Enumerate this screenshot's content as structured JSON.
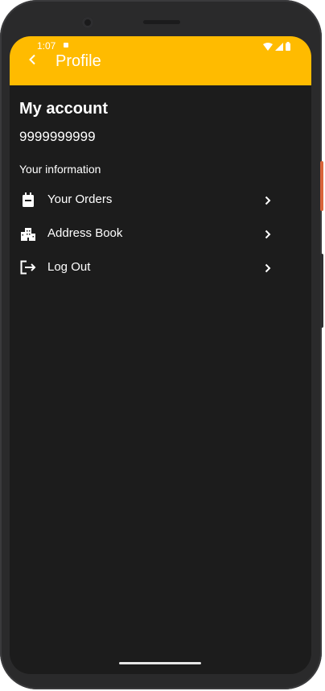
{
  "status_bar": {
    "time": "1:07",
    "icons": [
      "wifi-icon",
      "signal-icon",
      "battery-icon"
    ]
  },
  "app_bar": {
    "title": "Profile",
    "back_icon": "chevron-left-icon"
  },
  "account": {
    "title": "My account",
    "phone_number": "9999999999"
  },
  "section": {
    "label": "Your information"
  },
  "menu": {
    "items": [
      {
        "label": "Your Orders",
        "icon": "orders-bag-icon"
      },
      {
        "label": "Address Book",
        "icon": "buildings-icon"
      },
      {
        "label": "Log Out",
        "icon": "logout-icon"
      }
    ]
  },
  "colors": {
    "accent": "#FFBB00",
    "background": "#1C1C1C",
    "text": "#FFFFFF"
  }
}
